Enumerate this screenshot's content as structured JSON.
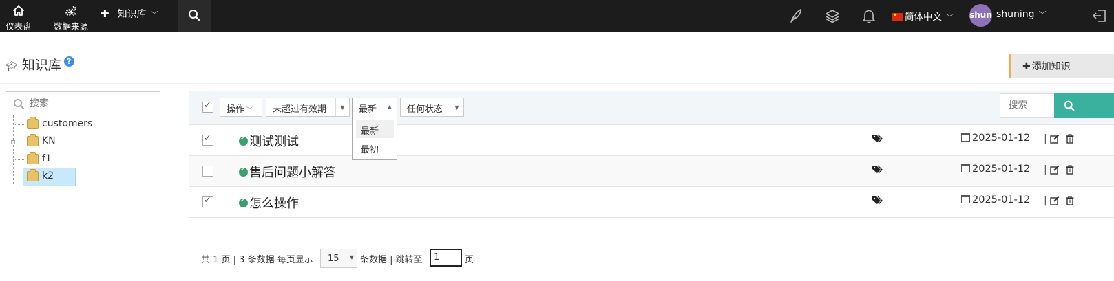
{
  "topbar": {
    "dashboard_label": "仪表盘",
    "datasource_label": "数据来源",
    "knowledge_label": "知识库",
    "language_label": "简体中文",
    "avatar_text": "shun",
    "username": "shuning"
  },
  "header": {
    "title": "知识库",
    "help_mark": "?",
    "add_button_label": "添加知识"
  },
  "sidebar": {
    "search_placeholder": "搜索",
    "tree": [
      {
        "label": "customers"
      },
      {
        "label": "KN"
      },
      {
        "label": "f1"
      },
      {
        "label": "k2",
        "selected": true
      }
    ]
  },
  "toolbar": {
    "select_all_checked": true,
    "action_label": "操作",
    "validity_label": "未超过有效期",
    "sort_label": "最新",
    "status_label": "任何状态",
    "search_placeholder": "搜索",
    "sort_options": [
      "最新",
      "最初"
    ]
  },
  "rows": [
    {
      "title": "测试测试",
      "date": "2025-01-12",
      "checked": true
    },
    {
      "title": "售后问题小解答",
      "date": "2025-01-12",
      "checked": false
    },
    {
      "title": "怎么操作",
      "date": "2025-01-12",
      "checked": true
    }
  ],
  "pager": {
    "total_pages_text": "共 1 页 | 3 条数据 每页显示",
    "page_size": "15",
    "after_size_text": "条数据 | 跳转至",
    "jump_value": "1",
    "page_suffix": "页"
  },
  "colors": {
    "topbar_bg": "#1c1c1c",
    "accent_teal": "#3ab09e",
    "add_button_border": "#f0ad4e",
    "selected_tree_bg": "#c8e8fb",
    "avatar_bg": "#8d72b7",
    "help_blue": "#3b8fdc"
  },
  "icons": [
    "home-icon",
    "gears-icon",
    "plus-icon",
    "search-icon",
    "feather-icon",
    "layers-icon",
    "bell-icon",
    "flag-cn-icon",
    "logout-icon",
    "graduation-cap-icon",
    "question-icon",
    "folder-icon",
    "check-circle-icon",
    "tags-icon",
    "calendar-icon",
    "edit-icon",
    "trash-icon"
  ]
}
